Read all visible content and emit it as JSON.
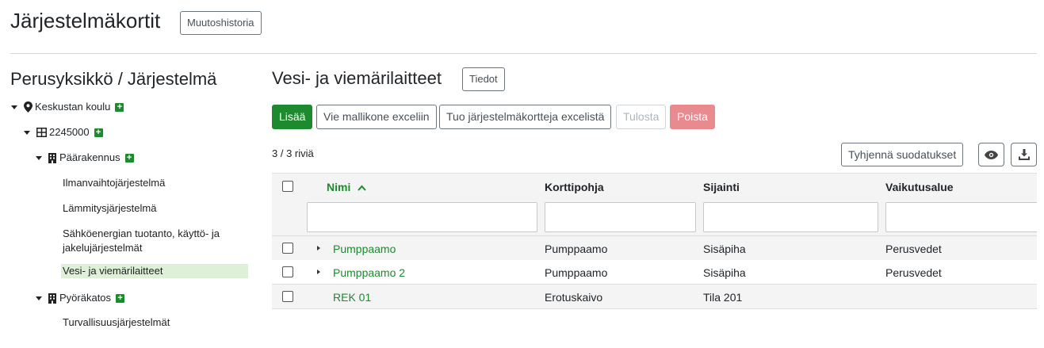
{
  "header": {
    "title": "Järjestelmäkortit",
    "history_button": "Muutoshistoria"
  },
  "left": {
    "title": "Perusyksikkö / Järjestelmä",
    "tree": {
      "site": "Keskustan koulu",
      "property": "2245000",
      "building1": "Päärakennus",
      "b1_items": [
        "Ilmanvaihtojärjestelmä",
        "Lämmitysjärjestelmä",
        "Sähköenergian tuotanto, käyttö- ja jakelujärjestelmät",
        "Vesi- ja viemärilaitteet"
      ],
      "building2": "Pyöräkatos",
      "b2_items": [
        "Turvallisuusjärjestelmät"
      ]
    }
  },
  "main": {
    "title": "Vesi- ja viemärilaitteet",
    "info_button": "Tiedot",
    "toolbar": {
      "add": "Lisää",
      "export_template": "Vie mallikone exceliin",
      "import_cards": "Tuo järjestelmäkortteja excelistä",
      "print": "Tulosta",
      "delete": "Poista"
    },
    "row_count": "3 / 3 riviä",
    "clear_filters": "Tyhjennä suodatukset",
    "table": {
      "columns": [
        "Nimi",
        "Korttipohja",
        "Sijainti",
        "Vaikutusalue"
      ],
      "rows": [
        {
          "name": "Pumppaamo",
          "template": "Pumppaamo",
          "location": "Sisäpiha",
          "area": "Perusvedet"
        },
        {
          "name": "Pumppaamo 2",
          "template": "Pumppaamo",
          "location": "Sisäpiha",
          "area": "Perusvedet"
        },
        {
          "name": "REK 01",
          "template": "Erotuskaivo",
          "location": "Tila 201",
          "area": ""
        }
      ]
    }
  },
  "colors": {
    "green": "#1e8a2e",
    "danger_disabled": "#e98a8f",
    "active_tree_bg": "#dff0d8"
  }
}
